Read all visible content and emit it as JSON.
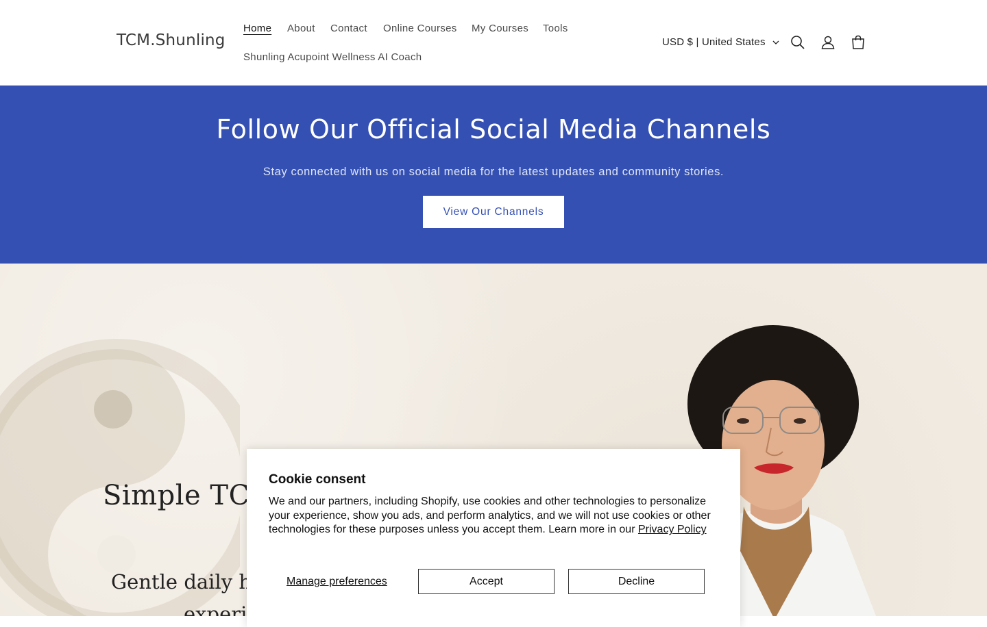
{
  "header": {
    "logo": "TCM.Shunling",
    "nav": [
      {
        "label": "Home",
        "active": true
      },
      {
        "label": "About"
      },
      {
        "label": "Contact"
      },
      {
        "label": "Online Courses"
      },
      {
        "label": "My Courses"
      },
      {
        "label": "Tools"
      },
      {
        "label": "Shunling Acupoint Wellness AI Coach"
      }
    ],
    "currency": "USD $ | United States",
    "icons": [
      "search-icon",
      "account-icon",
      "cart-icon"
    ]
  },
  "banner": {
    "title": "Follow Our Official Social Media Channels",
    "subtitle": "Stay connected with us on social media for the latest updates and community stories.",
    "button": "View Our Channels",
    "color": "#3450b3"
  },
  "hero": {
    "title": "Simple TC",
    "subtitle": "Gentle daily h",
    "subtitle2": "experi",
    "background": "#f1ebe2"
  },
  "cookie": {
    "title": "Cookie consent",
    "body": "We and our partners, including Shopify, use cookies and other technologies to personalize your experience, show you ads, and perform analytics, and we will not use cookies or other technologies for these purposes unless you accept them. Learn more in our ",
    "privacy_link": "Privacy Policy",
    "manage": "Manage preferences",
    "accept": "Accept",
    "decline": "Decline"
  }
}
